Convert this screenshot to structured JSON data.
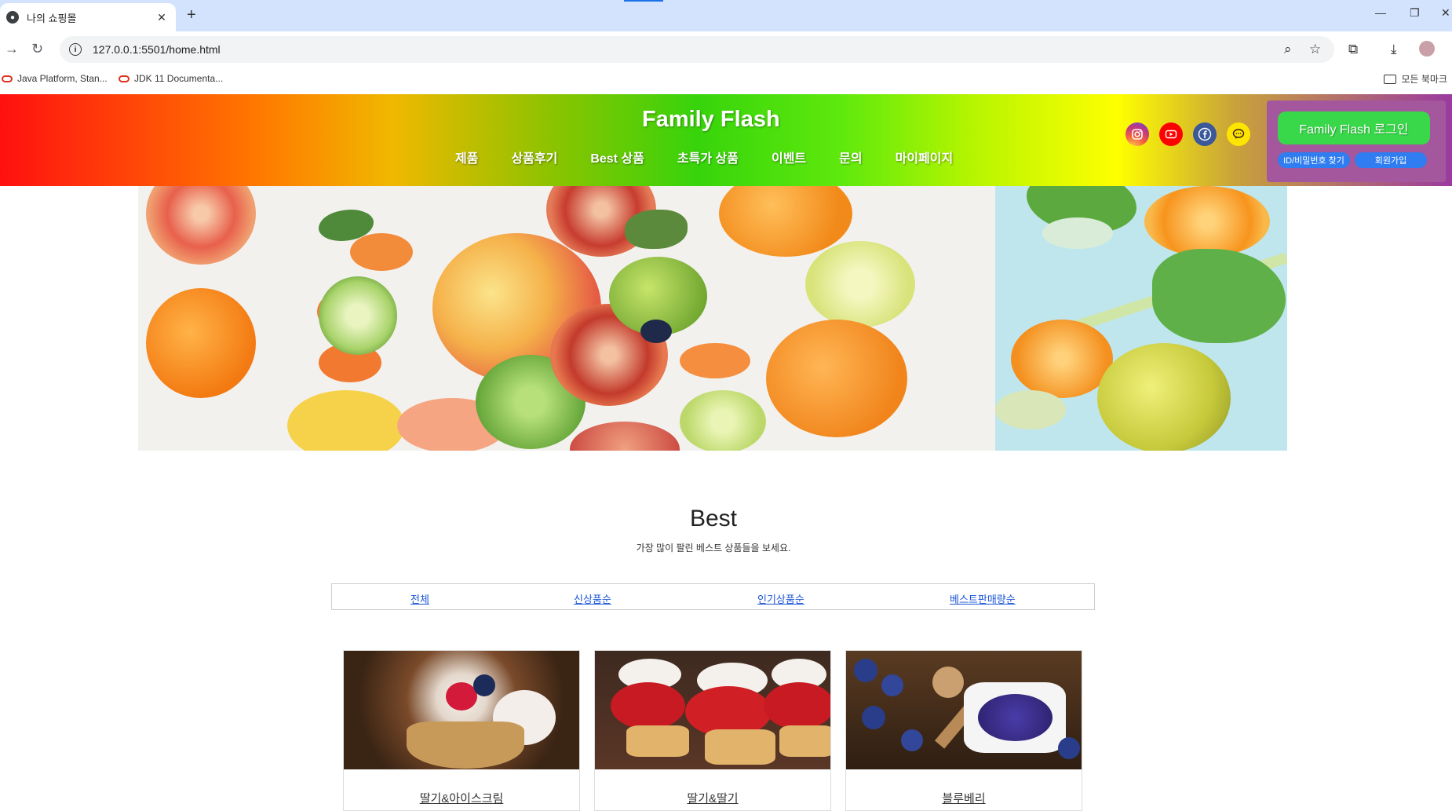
{
  "browser": {
    "tab_title": "나의 쇼핑몰",
    "url": "127.0.0.1:5501/home.html",
    "bookmarks": [
      "Java Platform, Stan...",
      "JDK 11 Documenta..."
    ],
    "all_bookmarks_label": "모든 북마크"
  },
  "header": {
    "brand": "Family Flash",
    "nav": [
      "제품",
      "상품후기",
      "Best 상품",
      "초특가 상품",
      "이벤트",
      "문의",
      "마이페이지"
    ],
    "social_icons": [
      "instagram-icon",
      "youtube-icon",
      "facebook-icon",
      "kakaotalk-icon"
    ],
    "login_label": "Family Flash 로그인",
    "find_id_label": "ID/비밀번호 찾기",
    "signup_label": "회원가입"
  },
  "best": {
    "title": "Best",
    "subtitle": "가장 많이 팔린 베스트 상품들을 보세요.",
    "filters": [
      "전체",
      "신상품순",
      "인기상품순",
      "베스트판매량순"
    ],
    "products": [
      "딸기&아이스크림",
      "딸기&딸기",
      "블루베리"
    ]
  }
}
